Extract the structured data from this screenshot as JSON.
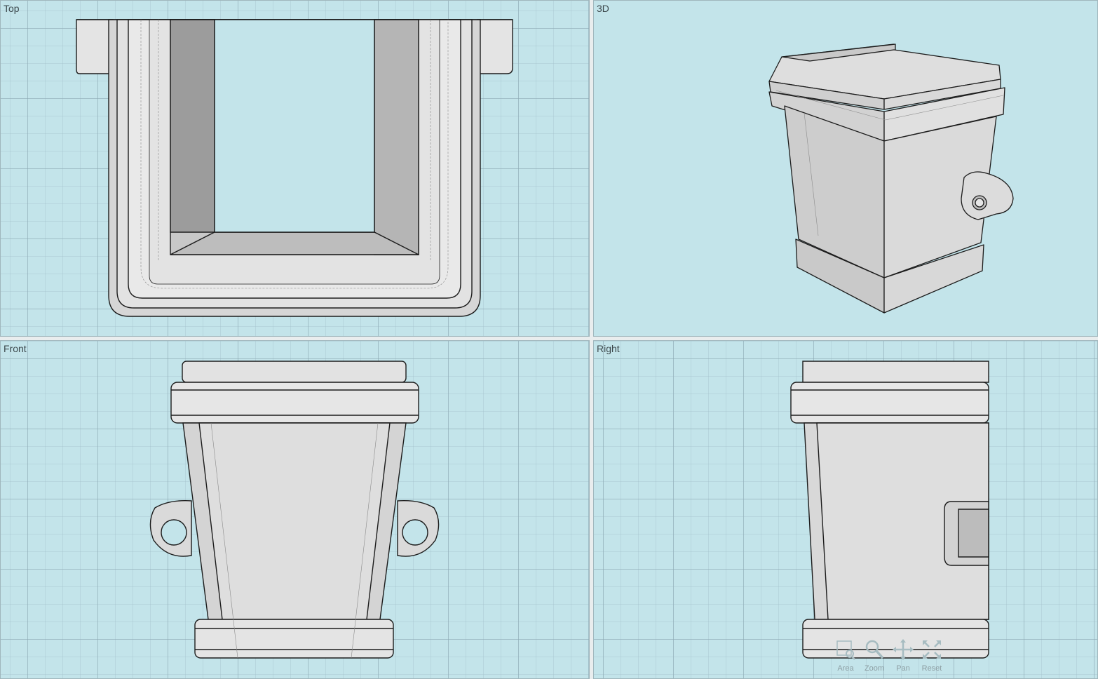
{
  "viewports": {
    "top": {
      "label": "Top"
    },
    "view3d": {
      "label": "3D"
    },
    "front": {
      "label": "Front"
    },
    "right": {
      "label": "Right"
    }
  },
  "nav_tools": [
    {
      "label": "Area",
      "icon": "area-zoom-icon"
    },
    {
      "label": "Zoom",
      "icon": "zoom-icon"
    },
    {
      "label": "Pan",
      "icon": "pan-icon"
    },
    {
      "label": "Reset",
      "icon": "reset-view-icon"
    }
  ],
  "colors": {
    "viewport_bg": "#c3e4ea",
    "part_fill": "#dcdcdc",
    "part_shade": "#a9a9a9",
    "edge": "#1c1c1c"
  }
}
